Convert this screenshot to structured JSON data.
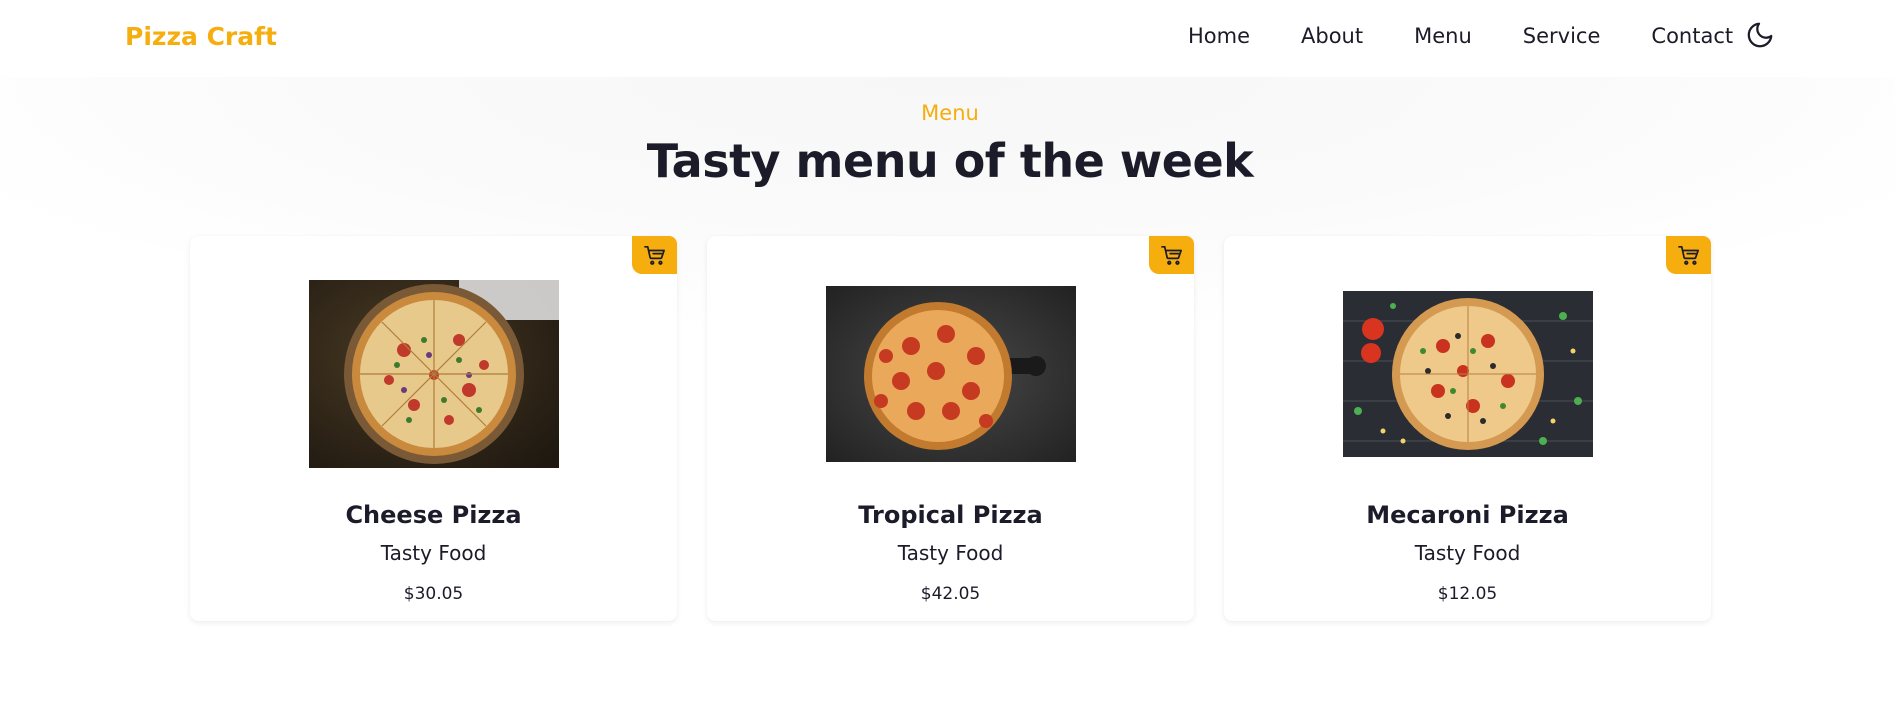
{
  "brand": {
    "name": "Pizza Craft"
  },
  "nav": {
    "links": [
      {
        "label": "Home"
      },
      {
        "label": "About"
      },
      {
        "label": "Menu"
      },
      {
        "label": "Service"
      },
      {
        "label": "Contact"
      }
    ],
    "theme_toggle_icon": "moon-icon"
  },
  "section": {
    "tag": "Menu",
    "title": "Tasty menu of the week"
  },
  "colors": {
    "accent": "#f6ad0e",
    "text": "#1c1b29"
  },
  "menu": {
    "items": [
      {
        "name": "Cheese Pizza",
        "subtitle": "Tasty Food",
        "price": "$30.05",
        "cart_icon": "cart-icon"
      },
      {
        "name": "Tropical Pizza",
        "subtitle": "Tasty Food",
        "price": "$42.05",
        "cart_icon": "cart-icon"
      },
      {
        "name": "Mecaroni Pizza",
        "subtitle": "Tasty Food",
        "price": "$12.05",
        "cart_icon": "cart-icon"
      }
    ]
  }
}
